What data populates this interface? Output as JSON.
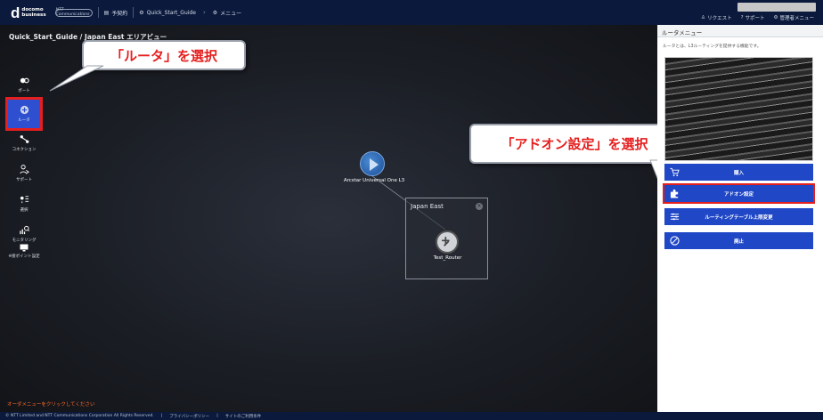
{
  "header": {
    "logo_mark": "d",
    "logo_line1": "docomo",
    "logo_line2": "business",
    "ntt_logo": "NTT Communications",
    "contract": "予契約",
    "breadcrumb_1": "Quick_Start_Guide",
    "breadcrumb_2": "メニュー",
    "links": {
      "request": "リクエスト",
      "support": "サポート",
      "admin": "管理者メニュー"
    }
  },
  "canvas": {
    "title": "Quick_Start_Guide / Japan East エリアビュー",
    "hint": "オーダメニューをクリックしてください"
  },
  "sidebar": {
    "items": [
      {
        "label": "ポート"
      },
      {
        "label": "ルータ"
      },
      {
        "label": "コネクション"
      },
      {
        "label": "サポート"
      },
      {
        "label": "選択"
      },
      {
        "label": "モニタリング"
      }
    ],
    "bottom_label": "※接ポイント設定"
  },
  "callouts": {
    "router": "「ルータ」を選択",
    "addon": "「アドオン設定」を選択"
  },
  "network": {
    "l3_label": "Arcstar Universal One L3",
    "region_title": "Japan East",
    "router_label": "Test_Router"
  },
  "panel": {
    "title": "ルータメニュー",
    "description": "ルータとは、L3ルーティングを提供する機能です。",
    "buttons": {
      "purchase": "購入",
      "addon": "アドオン設定",
      "routing_limit": "ルーティングテーブル上限変更",
      "cancel": "廃止"
    }
  },
  "footer": {
    "copyright": "© NTT Limited and NTT Communications Corporation All Rights Reserved.",
    "privacy": "プライバシーポリシー",
    "site_terms": "サイトのご利用条件"
  },
  "colors": {
    "accent": "#1f47c6",
    "highlight": "#e51e1e",
    "header": "#0b1a3c"
  }
}
